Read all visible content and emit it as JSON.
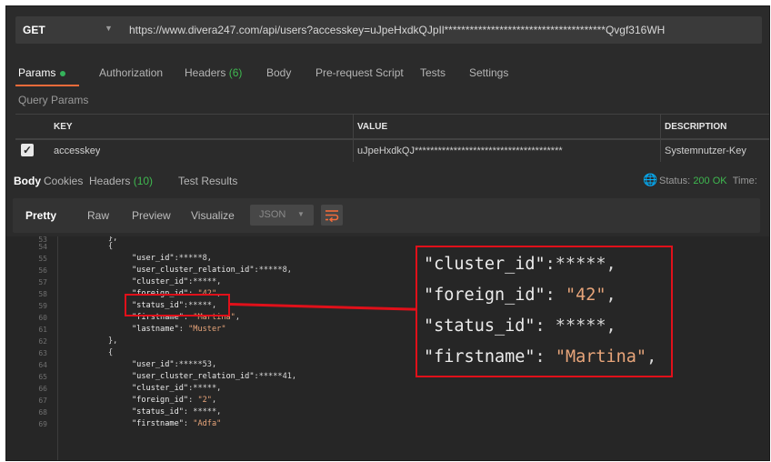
{
  "request": {
    "method": "GET",
    "url": "https://www.divera247.com/api/users?accesskey=uJpeHxdkQJpIl**************************************Qvgf316WH"
  },
  "request_tabs": {
    "params": "Params",
    "authorization": "Authorization",
    "headers": "Headers",
    "headers_count": "(6)",
    "body": "Body",
    "pre_request_script": "Pre-request Script",
    "tests": "Tests",
    "settings": "Settings"
  },
  "query_params": {
    "title": "Query Params",
    "columns": {
      "key": "KEY",
      "value": "VALUE",
      "description": "DESCRIPTION"
    },
    "rows": [
      {
        "checked": true,
        "key": "accesskey",
        "value": "uJpeHxdkQJ**************************************",
        "description": "Systemnutzer-Key"
      }
    ]
  },
  "response_tabs": {
    "body": "Body",
    "cookies": "Cookies",
    "headers": "Headers",
    "headers_count": "(10)",
    "test_results": "Test Results",
    "status_label": "Status:",
    "status_value": "200 OK",
    "time_label": "Time:"
  },
  "response_toolbar": {
    "pretty": "Pretty",
    "raw": "Raw",
    "preview": "Preview",
    "visualize": "Visualize",
    "format": "JSON"
  },
  "code_lines": {
    "l53": {
      "num": "53",
      "text": "},"
    },
    "l54": {
      "num": "54",
      "text": "{"
    },
    "l55": {
      "num": "55",
      "key": "\"user_id\"",
      "rest": ":*****8,"
    },
    "l56": {
      "num": "56",
      "key": "\"user_cluster_relation_id\"",
      "rest": ":*****8,"
    },
    "l57": {
      "num": "57",
      "key": "\"cluster_id\"",
      "rest": ":*****,"
    },
    "l58": {
      "num": "58",
      "key": "\"foreign_id\"",
      "rest_pre": ": ",
      "str": "\"42\"",
      "rest": ","
    },
    "l59": {
      "num": "59",
      "key": "\"status_id\"",
      "rest": ":*****,"
    },
    "l60": {
      "num": "60",
      "key": "\"firstname\"",
      "rest_pre": ": ",
      "str": "\"Martina\"",
      "rest": ","
    },
    "l61": {
      "num": "61",
      "key": "\"lastname\"",
      "rest_pre": ": ",
      "str": "\"Muster\""
    },
    "l62": {
      "num": "62",
      "text": "},"
    },
    "l63": {
      "num": "63",
      "text": "{"
    },
    "l64": {
      "num": "64",
      "key": "\"user_id\"",
      "rest": ":*****53,"
    },
    "l65": {
      "num": "65",
      "key": "\"user_cluster_relation_id\"",
      "rest": ":*****41,"
    },
    "l66": {
      "num": "66",
      "key": "\"cluster_id\"",
      "rest": ":*****,"
    },
    "l67": {
      "num": "67",
      "key": "\"foreign_id\"",
      "rest_pre": ": ",
      "str": "\"2\"",
      "rest": ","
    },
    "l68": {
      "num": "68",
      "key": "\"status_id\"",
      "rest": ": *****,"
    },
    "l69": {
      "num": "69",
      "key": "\"firstname\"",
      "rest_pre": ": ",
      "str": "\"Adfa\""
    }
  },
  "zoom": {
    "z1": {
      "key": "\"cluster_id\"",
      "rest": ":*****,"
    },
    "z2": {
      "key": "\"foreign_id\"",
      "rest_pre": ": ",
      "str": "\"42\"",
      "rest": ","
    },
    "z3": {
      "key": "\"status_id\"",
      "rest": ": *****,"
    },
    "z4": {
      "key": "\"firstname\"",
      "rest_pre": ": ",
      "str": "\"Martina\"",
      "rest": ","
    }
  }
}
